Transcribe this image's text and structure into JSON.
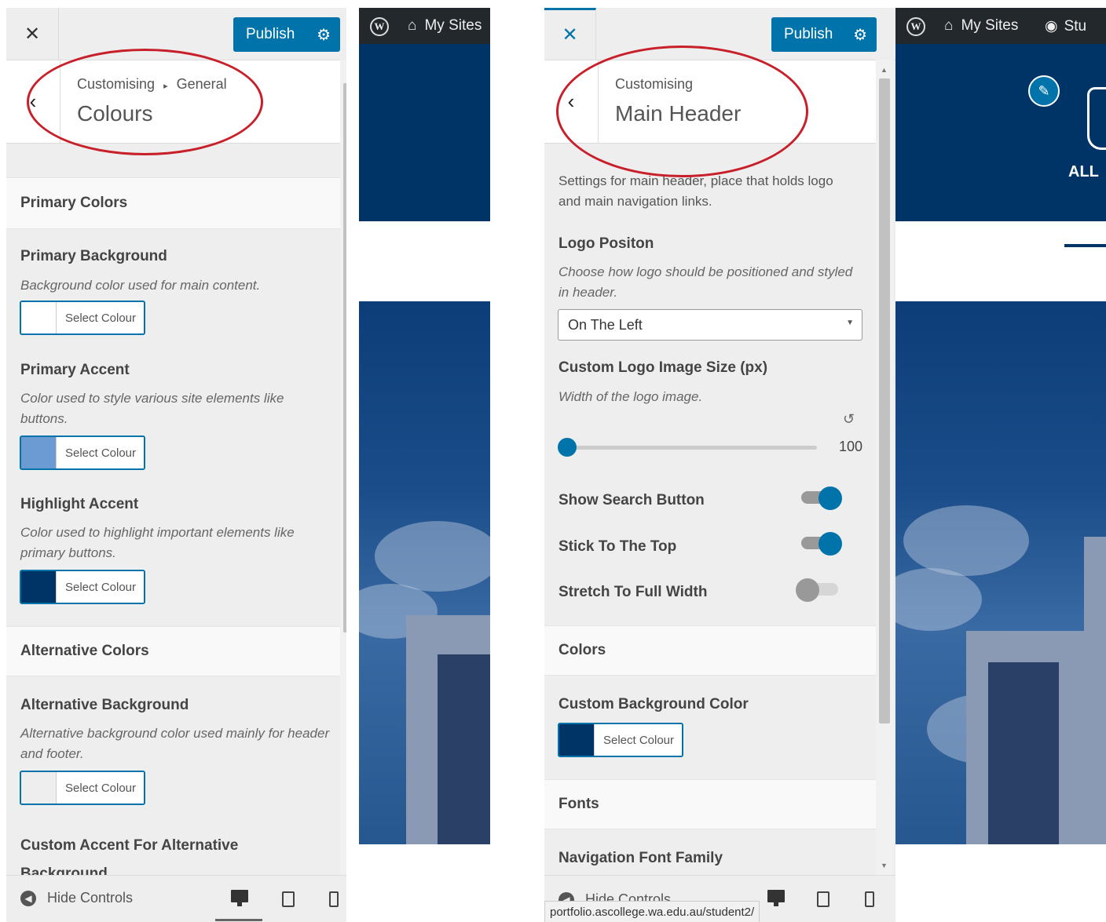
{
  "colors": {
    "accent": "#0073aa",
    "navy": "#003366",
    "annotation": "#c8202a",
    "primary_background_swatch": "#ffffff",
    "primary_accent_swatch": "#6b9bd2",
    "highlight_accent_swatch": "#003366",
    "alt_background_swatch": "#eeeeee",
    "custom_bg_swatch": "#003366"
  },
  "left": {
    "publish_label": "Publish",
    "breadcrumb_root": "Customising",
    "breadcrumb_sep": "▸",
    "breadcrumb_parent": "General",
    "title": "Colours",
    "sections": {
      "primary_colors": "Primary Colors",
      "alternative_colors": "Alternative Colors"
    },
    "controls": [
      {
        "label": "Primary Background",
        "description": "Background color used for main content.",
        "button": "Select Colour"
      },
      {
        "label": "Primary Accent",
        "description": "Color used to style various site elements like buttons.",
        "button": "Select Colour"
      },
      {
        "label": "Highlight Accent",
        "description": "Color used to highlight important elements like primary buttons.",
        "button": "Select Colour"
      },
      {
        "label": "Alternative Background",
        "description": "Alternative background color used mainly for header and footer.",
        "button": "Select Colour"
      },
      {
        "label": "Custom Accent For Alternative Background"
      }
    ],
    "hide_controls": "Hide Controls",
    "adminbar": {
      "my_sites": "My Sites"
    }
  },
  "right": {
    "publish_label": "Publish",
    "breadcrumb_root": "Customising",
    "title": "Main Header",
    "intro": "Settings for main header, place that holds logo and main navigation links.",
    "logo_position": {
      "label": "Logo Positon",
      "description": "Choose how logo should be positioned and styled in header.",
      "selected": "On The Left"
    },
    "logo_size": {
      "label": "Custom Logo Image Size (px)",
      "description": "Width of the logo image.",
      "value": "100",
      "slider_fraction": 0.0
    },
    "toggles": [
      {
        "label": "Show Search Button",
        "on": true
      },
      {
        "label": "Stick To The Top",
        "on": true
      },
      {
        "label": "Stretch To Full Width",
        "on": false
      }
    ],
    "sections": {
      "colors": "Colors",
      "fonts": "Fonts"
    },
    "custom_bg": {
      "label": "Custom Background Color",
      "button": "Select Colour"
    },
    "nav_font_family": "Navigation Font Family",
    "hide_controls": "Hide Controls",
    "url_tooltip": "portfolio.ascollege.wa.edu.au/student2/",
    "adminbar": {
      "my_sites": "My Sites",
      "student": "Stu"
    },
    "site_logo_text": "ALL"
  }
}
